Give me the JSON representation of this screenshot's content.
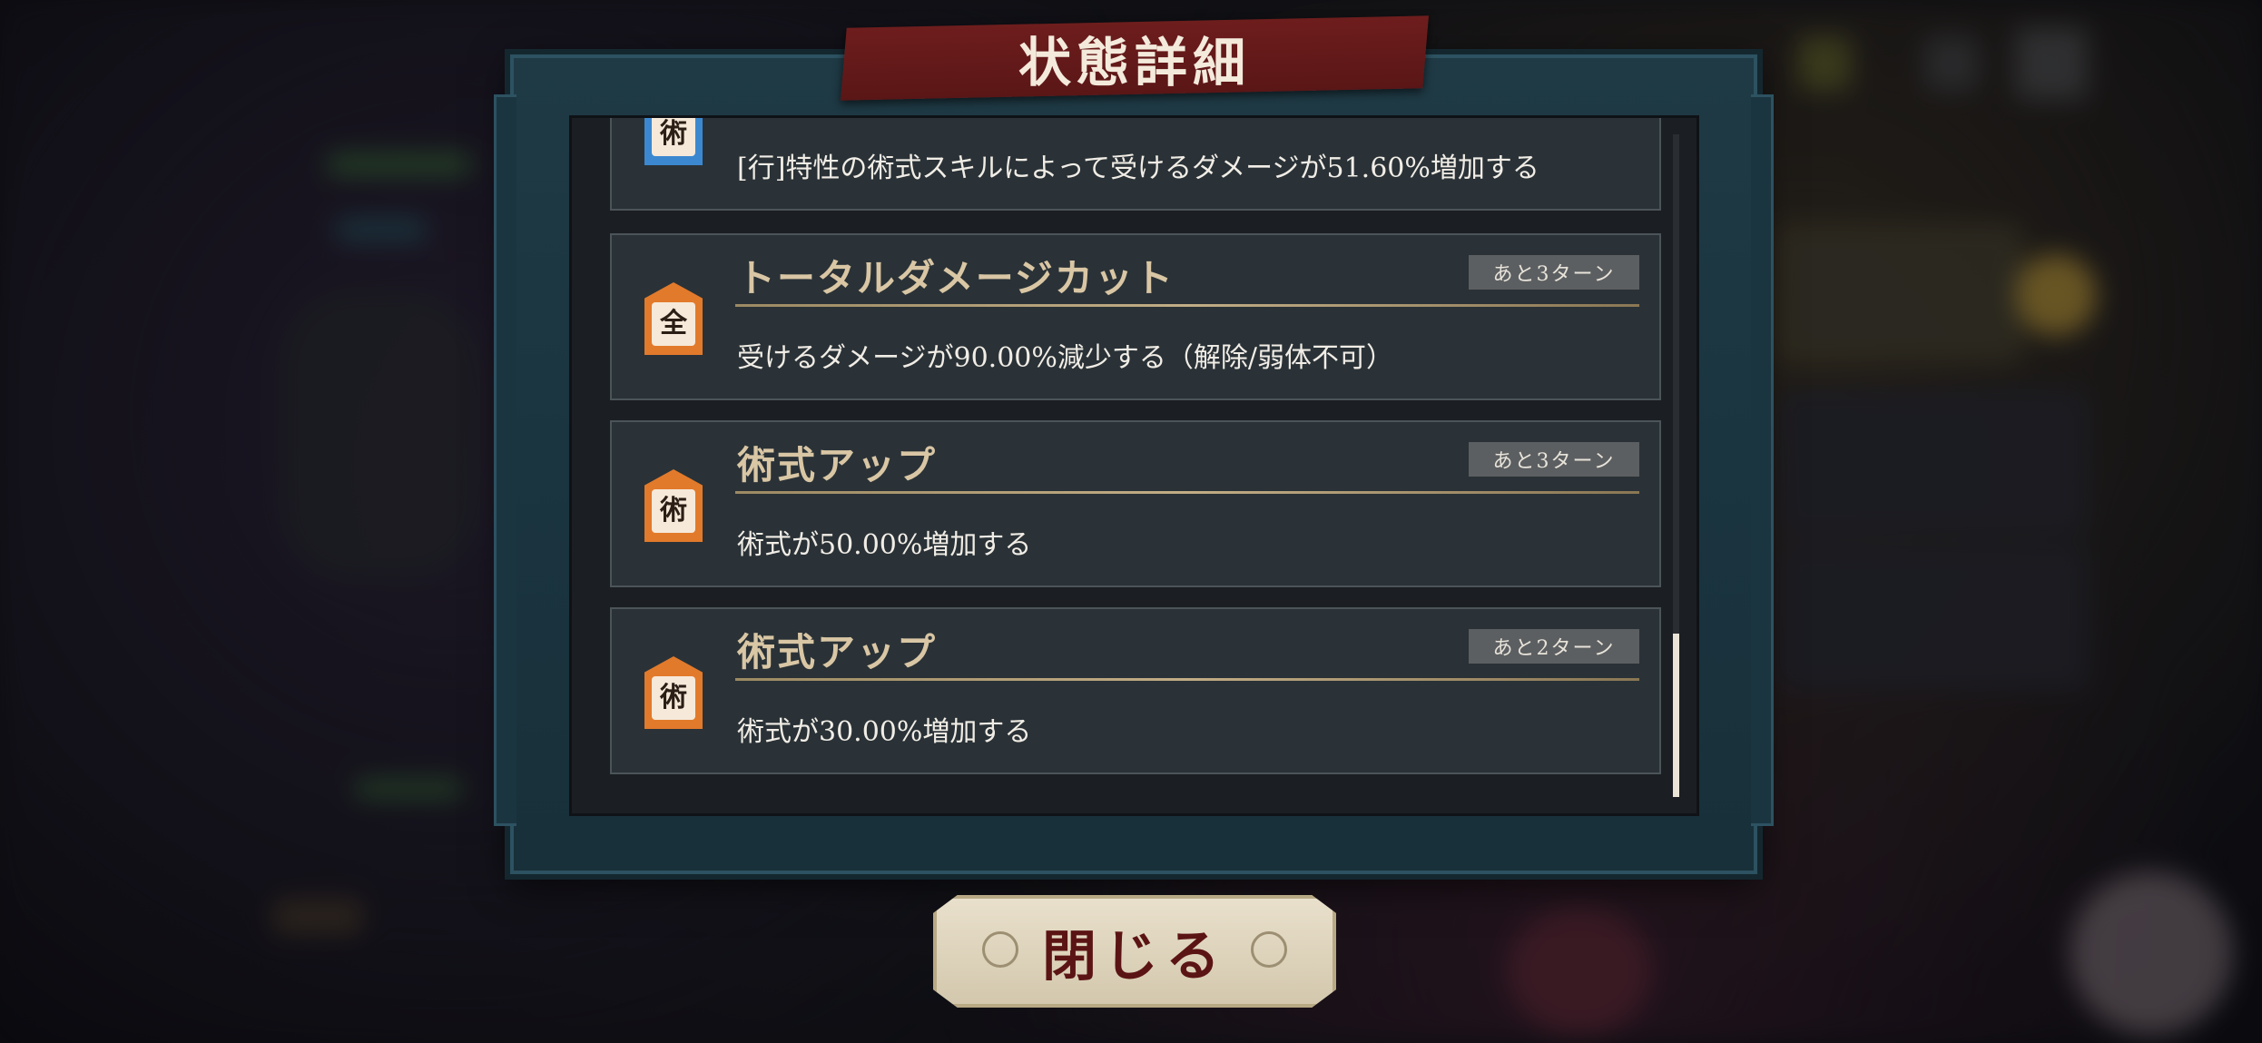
{
  "dialog": {
    "title": "状態詳細",
    "close_label": "閉じる"
  },
  "effects": [
    {
      "icon": "jutsu-icon",
      "badge_glyph": "術",
      "badge_color": "#3c88d0",
      "name": "",
      "turns": "",
      "description": "[行]特性の術式スキルによって受けるダメージが51.60%増加する"
    },
    {
      "icon": "all-icon",
      "badge_glyph": "全",
      "badge_color": "#e27a2b",
      "name": "トータルダメージカット",
      "turns": "あと3ターン",
      "description": "受けるダメージが90.00%減少する（解除/弱体不可）"
    },
    {
      "icon": "jutsu-icon",
      "badge_glyph": "術",
      "badge_color": "#e27a2b",
      "name": "術式アップ",
      "turns": "あと3ターン",
      "description": "術式が50.00%増加する"
    },
    {
      "icon": "jutsu-icon",
      "badge_glyph": "術",
      "badge_color": "#e27a2b",
      "name": "術式アップ",
      "turns": "あと2ターン",
      "description": "術式が30.00%増加する"
    }
  ],
  "scroll": {
    "position": "bottom"
  }
}
